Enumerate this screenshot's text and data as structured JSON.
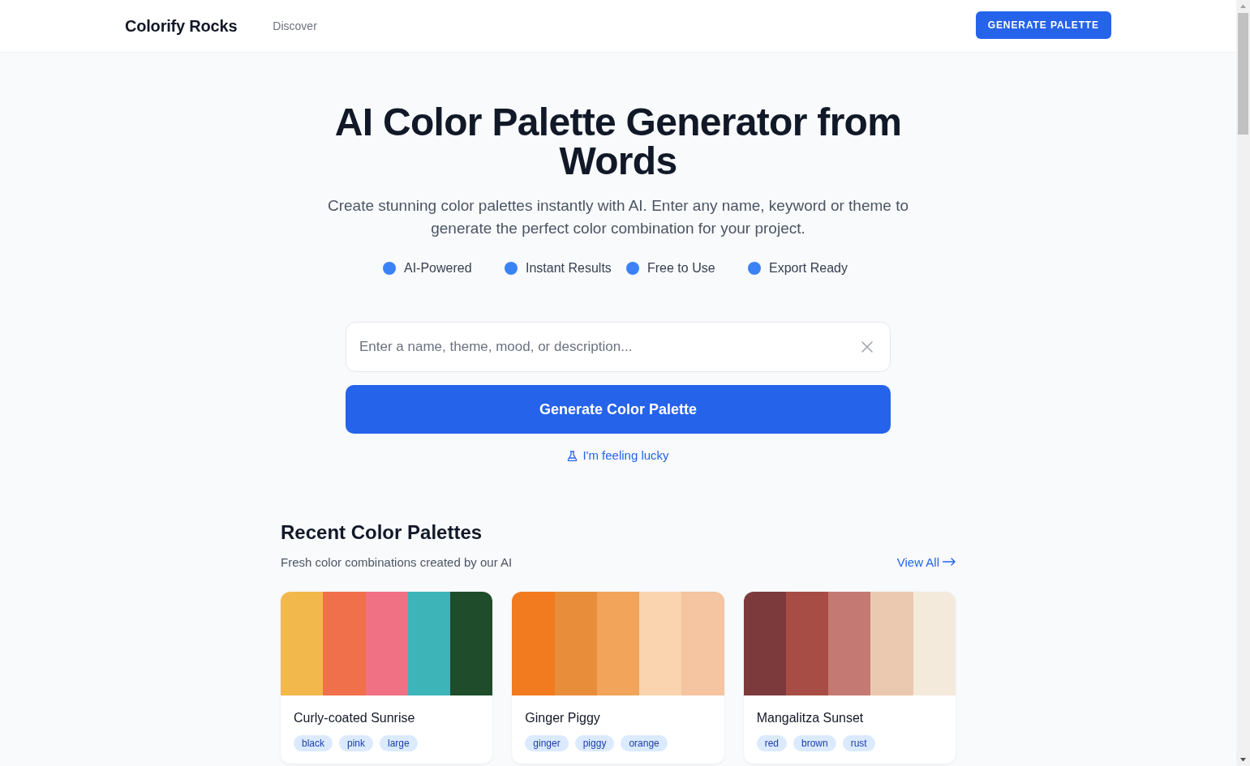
{
  "header": {
    "logo": "Colorify Rocks",
    "nav": [
      {
        "label": "Discover"
      }
    ],
    "button": "GENERATE PALETTE"
  },
  "hero": {
    "title": "AI Color Palette Generator from Words",
    "subtitle": "Create stunning color palettes instantly with AI. Enter any name, keyword or theme to generate the perfect color combination for your project.",
    "features": [
      "AI-Powered",
      "Instant Results",
      "Free to Use",
      "Export Ready"
    ]
  },
  "search": {
    "placeholder": "Enter a name, theme, mood, or description...",
    "button": "Generate Color Palette",
    "lucky_link": "I'm feeling lucky"
  },
  "recent": {
    "title": "Recent Color Palettes",
    "subtitle": "Fresh color combinations created by our AI",
    "view_all": "View All",
    "palettes": [
      {
        "name": "Curly-coated Sunrise",
        "swatches": [
          {
            "color": "#f2b84b"
          },
          {
            "color": "#f0704c"
          },
          {
            "color": "#f07084"
          },
          {
            "color": "#3db5b8"
          },
          {
            "color": "#1f4d2b"
          }
        ],
        "tags": [
          "black",
          "pink",
          "large"
        ]
      },
      {
        "name": "Ginger Piggy",
        "swatches": [
          {
            "color": "#f27a1f"
          },
          {
            "color": "#e88e3a"
          },
          {
            "color": "#f2a55a"
          },
          {
            "color": "#f9d4ae"
          },
          {
            "color": "#f5c4a1"
          }
        ],
        "tags": [
          "ginger",
          "piggy",
          "orange"
        ]
      },
      {
        "name": "Mangalitza Sunset",
        "swatches": [
          {
            "color": "#7d3a3c"
          },
          {
            "color": "#a84d45"
          },
          {
            "color": "#c47a72"
          },
          {
            "color": "#ebc8b0"
          },
          {
            "color": "#f3eadc"
          }
        ],
        "tags": [
          "red",
          "brown",
          "rust"
        ]
      }
    ]
  }
}
